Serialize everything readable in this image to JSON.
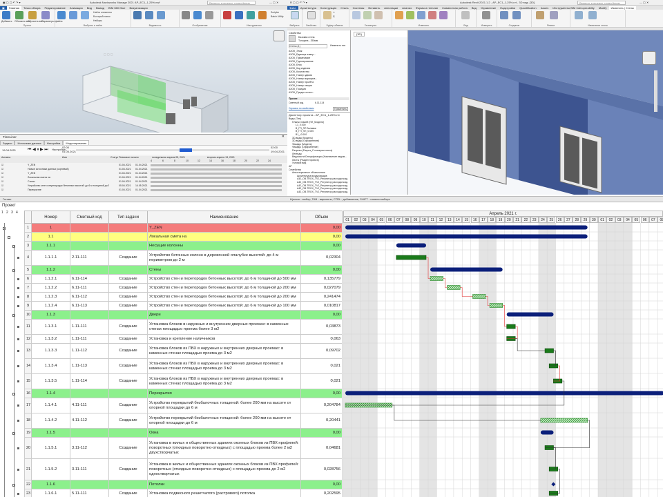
{
  "navisworks": {
    "title": "Autodesk Navisworks Manage 2021   АР_ЕС1_1-25%.nwf",
    "search_placeholder": "Введите ключевое слово/фразу",
    "tabs": [
      "Главная",
      "Точка обзора",
      "Редактирование",
      "Анимация",
      "Вид",
      "Вывод",
      "BIM 360 Glue",
      "Визуализация"
    ],
    "groups": [
      "Проект",
      "Выбрать и найти",
      "Видимость",
      "Отображение",
      "Инструменты"
    ],
    "buttons": [
      "Добавить",
      "Обновить все",
      "Сбросить все",
      "Параметры файла",
      "Выбрать",
      "Сохранить выбор",
      "Выбрать все",
      "Найти элементы",
      "Быстрый поиск",
      "Наборы",
      "Скрыть",
      "Скрыть невыбранное",
      "Отобразить все",
      "Ссылки",
      "Быстрые свойства",
      "Свойства",
      "Clash Detective",
      "TimeLiner",
      "Quantification",
      "Autodesk Rendering",
      "Animator",
      "Scripter",
      "Appearance Profiler",
      "Batch Utility",
      "Сравнить",
      "DataTools",
      "App Manager"
    ]
  },
  "timeliner": {
    "title": "TimeLiner",
    "tabs": [
      "Задачи",
      "Источники данных",
      "Настройка",
      "Моделирование"
    ],
    "play_time": "02:00",
    "date_start": "19.04.2021",
    "date_end": "01.04.2021",
    "date_right": "19.04.2021",
    "cols": [
      "Активна",
      "Имя",
      "Статус",
      "Плановое начало",
      "Плановое окончание",
      "понедельник апреля 05, 2021",
      "вторник апреля 13, 2021"
    ],
    "rows": [
      {
        "n": "Y_ZEN",
        "d1": "01.04.2021",
        "d2": "01.04.2021"
      },
      {
        "n": "Новые источники данных (корневой)",
        "d1": "01.04.2021",
        "d2": "01.04.2021"
      },
      {
        "n": "Y_ZEN",
        "d1": "01.04.2021",
        "d2": "01.04.2021"
      },
      {
        "n": "Локальная смета на",
        "d1": "01.04.2021",
        "d2": "01.04.2021"
      },
      {
        "n": "Стены",
        "d1": "01.04.2021",
        "d2": "01.04.2021"
      },
      {
        "n": "Устройство стен и перегородок бетонных высотой: до 6 м толщиной до 500 мм",
        "d1": "05.04.2021",
        "d2": "14.05.2021"
      },
      {
        "n": "Перекрытие",
        "d1": "01.04.2021",
        "d2": "01.04.2021"
      }
    ],
    "scale": [
      "4",
      "6",
      "8",
      "10",
      "12",
      "14",
      "16",
      "18",
      "20",
      "22",
      "24"
    ]
  },
  "revit": {
    "title": "Autodesk Revit 2021.1.2 - АР_ЕС1_1-25%.rvt - 3D вид: {3D}",
    "search_placeholder": "Введите ключевое слово/фразу",
    "tabs": [
      "Файл",
      "Архитектура",
      "Конструкция",
      "Сталь",
      "Системы",
      "Вставить",
      "Аннотации",
      "Анализ",
      "Формы и генплан",
      "Совместная работа",
      "Вид",
      "Управление",
      "Надстройки",
      "Quantification",
      "Issues",
      "Инструменты BIM Interoperability",
      "Modify",
      "Изменить | Стены"
    ],
    "groups": [
      "Выбрать",
      "Свойства",
      "Буфер обмена",
      "Геометрия",
      "Изменить",
      "Вид",
      "Измерить",
      "Создание",
      "Режим",
      "Изменение стены"
    ],
    "doc_tab": "{3D}",
    "properties": {
      "header": "Свойства",
      "type_name": "Базовая стена",
      "type_sub": "Толщина - 250мм",
      "filter": "Стены (1)",
      "edit_type": "Изменить тип",
      "items": [
        "АЗОК_Этаж",
        "АЗОК_Единица измер...",
        "АЗОК_Примечание",
        "АЗОК_Группирование",
        "АЗОК_Блок",
        "АЗОК_Код изделия",
        "АЗОК_Количество",
        "АЗОК_Номер здания",
        "АЗОК_Номер маркиров...",
        "АЗОК_Номер пролёта",
        "АЗОК_Номер секции",
        "АЗОК_Позиция",
        "АЗОК_Предел огнест..."
      ],
      "other_header": "Прочее",
      "smeta_label": "Сметный код",
      "smeta_value": "6.11-114",
      "help": "Справка по свойствам",
      "apply": "Применить"
    },
    "browser": {
      "header": "Диспетчер проекта - АР_ЕС1_1-25%.rvt",
      "items": [
        "Виды (Тип)",
        "Планы этажей (ПЛ_Модели)",
        "L1_0.000",
        "В_ГП_ПЛ Заливки",
        "В_ГП_ПЛ_0.000",
        "В1_-0.000",
        "3D-виды (Модель)",
        "3D-виды (Оформление)",
        "Фасады (Модель)",
        "Фасады (Оформление)",
        "Разрезы (Разрез_С номером листа)",
        "Легенды",
        "Ведомости/Спецификации (Назначение ведом...",
        "Листы (Раздел проекта)",
        "Узловой вид",
        "АР",
        "Семейства",
        "Аннотационные обозначения",
        "Архитектура воздуховодов",
        "А42_OB.TROX_TVJ_Регулятор расхода возд.",
        "А42_OB.TROX_TVJ_Регулятор расхода возд.",
        "А42_OB.TROX_TVJ_Регулятор расхода возд.",
        "А42_OB.TROX_TVJ_Регулятор расхода возд.",
        "А42_OB.TROX_TVJ_Регулятор расхода возд."
      ]
    },
    "status": "Щелчок - выбор, TAB - варианты, CTRL - добавление, SHIFT - отмена выбора"
  },
  "navis_status": "Готово",
  "project": {
    "label": "Проект",
    "outline_levels": [
      "1",
      "2",
      "3",
      "4"
    ],
    "columns": {
      "number": "Номер",
      "code": "Сметный код",
      "type": "Тип задачи",
      "name": "Наименование",
      "volume": "Объем"
    },
    "rows": [
      {
        "id": "1",
        "num": "1",
        "code": "",
        "type": "",
        "name": "Y_ZEN",
        "vol": "0,00",
        "color": "red",
        "h": 1
      },
      {
        "id": "2",
        "num": "1.1",
        "code": "",
        "type": "",
        "name": "Локальная смета на",
        "vol": "0,00",
        "color": "yellow",
        "h": 1
      },
      {
        "id": "3",
        "num": "1.1.1",
        "code": "",
        "type": "",
        "name": "Несущие колонны",
        "vol": "0,00",
        "color": "green",
        "h": 1
      },
      {
        "id": "4",
        "num": "1.1.1.1",
        "code": "2.11-111",
        "type": "Создание",
        "name": "Устройство бетонных колонн в деревянной опалубке высотой: до 4 м периметром до 2 м",
        "vol": "0,02304",
        "color": "",
        "h": 2
      },
      {
        "id": "5",
        "num": "1.1.2",
        "code": "",
        "type": "",
        "name": "Стены",
        "vol": "0,00",
        "color": "green",
        "h": 1
      },
      {
        "id": "6",
        "num": "1.1.2.1",
        "code": "6.11-114",
        "type": "Создание",
        "name": "Устройство стен и перегородок бетонных высотой: до 6 м толщиной до 500 мм",
        "vol": "0,135779",
        "color": "",
        "h": 1
      },
      {
        "id": "7",
        "num": "1.1.2.2",
        "code": "6.11-111",
        "type": "Создание",
        "name": "Устройство стен и перегородок бетонных высотой: до 6 м толщиной до 200 мм",
        "vol": "0,027079",
        "color": "",
        "h": 1
      },
      {
        "id": "8",
        "num": "1.1.2.3",
        "code": "6.11-112",
        "type": "Создание",
        "name": "Устройство стен и перегородок бетонных высотой: до 6 м толщиной до 200 мм",
        "vol": "0,241474",
        "color": "",
        "h": 1
      },
      {
        "id": "9",
        "num": "1.1.2.4",
        "code": "6.11-113",
        "type": "Создание",
        "name": "Устройство стен и перегородок бетонных высотой: до 6 м толщиной до 100 мм",
        "vol": "0,010817",
        "color": "",
        "h": 1
      },
      {
        "id": "10",
        "num": "1.1.3",
        "code": "",
        "type": "",
        "name": "Двери",
        "vol": "0,00",
        "color": "green",
        "h": 1
      },
      {
        "id": "11",
        "num": "1.1.3.1",
        "code": "1.11-111",
        "type": "Создание",
        "name": "Установка блоков в наружных и внутренних дверных проемах: в каменных стенах площадью проема более 3 м2",
        "vol": "0,03873",
        "color": "",
        "h": 2
      },
      {
        "id": "12",
        "num": "1.1.3.2",
        "code": "1.11-111",
        "type": "Создание",
        "name": "Установка и крепление наличников",
        "vol": "0,063",
        "color": "",
        "h": 1
      },
      {
        "id": "13",
        "num": "1.1.3.3",
        "code": "1.11-112",
        "type": "Создание",
        "name": "Установка блоков из ПВХ в наружных и внутренних дверных проемах: в каменных стенах площадью проема до 3 м2",
        "vol": "0,09702",
        "color": "",
        "h": 2
      },
      {
        "id": "14",
        "num": "1.1.3.4",
        "code": "1.11-113",
        "type": "Создание",
        "name": "Установка блоков из ПВХ в наружных и внутренних дверных проемах: в каменных стенах площадью проема до 3 м2",
        "vol": "0,021",
        "color": "",
        "h": 2
      },
      {
        "id": "15",
        "num": "1.1.3.5",
        "code": "1.11-114",
        "type": "Создание",
        "name": "Установка блоков из ПВХ в наружных и внутренних дверных проемах: в каменных стенах площадью проема до 3 м2",
        "vol": "0,021",
        "color": "",
        "h": 2
      },
      {
        "id": "16",
        "num": "1.1.4",
        "code": "",
        "type": "",
        "name": "Перекрытия",
        "vol": "0,00",
        "color": "green",
        "h": 1
      },
      {
        "id": "17",
        "num": "1.1.4.1",
        "code": "4.11-111",
        "type": "Создание",
        "name": "Устройство перекрытий безбалочных толщиной: более 200 мм на высоте от опорной площадки до 6 м",
        "vol": "0,204784",
        "color": "",
        "h": 2
      },
      {
        "id": "18",
        "num": "1.1.4.2",
        "code": "4.11-112",
        "type": "Создание",
        "name": "Устройство перекрытий безбалочных толщиной: более 200 мм на высоте от опорной площадки до 6 м",
        "vol": "0,20441",
        "color": "",
        "h": 2
      },
      {
        "id": "19",
        "num": "1.1.5",
        "code": "",
        "type": "",
        "name": "Окна",
        "vol": "0,00",
        "color": "green",
        "h": 1
      },
      {
        "id": "20",
        "num": "1.1.5.1",
        "code": "3.11-112",
        "type": "Создание",
        "name": "Установка в жилых и общественных зданиях оконных блоков из ПВХ профилей: поворотных (откидных поворотно-откидных) с площадью проема более 2 м2 двухстворчатых",
        "vol": "0,04681",
        "color": "",
        "h": 3
      },
      {
        "id": "21",
        "num": "1.1.5.2",
        "code": "3.11-111",
        "type": "Создание",
        "name": "Установка в жилых и общественных зданиях оконных блоков из ПВХ профилей: поворотных (откидных поворотно-откидных) с площадью проема до 2 м2 одностворчатых",
        "vol": "0,028756",
        "color": "",
        "h": 3
      },
      {
        "id": "22",
        "num": "1.1.6",
        "code": "",
        "type": "",
        "name": "Потолки",
        "vol": "0,00",
        "color": "green",
        "h": 1
      },
      {
        "id": "23",
        "num": "1.1.6.1",
        "code": "5.11-111",
        "type": "Создание",
        "name": "Установка подвесного решетчатого (растрового) потолка",
        "vol": "0,202595",
        "color": "",
        "h": 1
      }
    ]
  },
  "gantt": {
    "month": "Апрель 2021 г.",
    "days": [
      "01",
      "02",
      "03",
      "04",
      "05",
      "06",
      "07",
      "08",
      "09",
      "10",
      "11",
      "12",
      "13",
      "14",
      "15",
      "16",
      "17",
      "18",
      "19",
      "20",
      "21",
      "22",
      "23",
      "24",
      "25",
      "26",
      "27",
      "28",
      "29",
      "30",
      "01",
      "02",
      "03",
      "04",
      "05",
      "06",
      "07",
      "08"
    ],
    "weekend_days": [
      "03",
      "04",
      "10",
      "11",
      "17",
      "18",
      "24",
      "25",
      "01",
      "02"
    ],
    "colors": {
      "summary": "#0b1f7a",
      "task": "#1a7a1a",
      "link": "#e03030",
      "link_gray": "#333333",
      "weekend": "#e4e4e4"
    },
    "bars": [
      {
        "row": 1,
        "kind": "summary",
        "start": 1,
        "end": 29
      },
      {
        "row": 2,
        "kind": "summary",
        "start": 1,
        "end": 29
      },
      {
        "row": 3,
        "kind": "summary",
        "start": 7,
        "end": 10
      },
      {
        "row": 4,
        "kind": "task",
        "start": 7,
        "end": 10
      },
      {
        "row": 5,
        "kind": "summary",
        "start": 11,
        "end": 19
      },
      {
        "row": 6,
        "kind": "hatch",
        "start": 11,
        "end": 12
      },
      {
        "row": 7,
        "kind": "hatch",
        "start": 13,
        "end": 14
      },
      {
        "row": 8,
        "kind": "hatch",
        "start": 16,
        "end": 17
      },
      {
        "row": 9,
        "kind": "hatch",
        "start": 18,
        "end": 19
      },
      {
        "row": 10,
        "kind": "summary",
        "start": 20,
        "end": 25
      },
      {
        "row": 11,
        "kind": "task",
        "start": 20,
        "end": 20.5
      },
      {
        "row": 12,
        "kind": "task",
        "start": 20,
        "end": 20.5
      },
      {
        "row": 13,
        "kind": "task",
        "start": 24.5,
        "end": 25
      },
      {
        "row": 14,
        "kind": "task",
        "start": 25,
        "end": 25.5
      },
      {
        "row": 15,
        "kind": "task",
        "start": 25.5,
        "end": 26
      },
      {
        "row": 16,
        "kind": "summary",
        "start": 1,
        "end": 38
      },
      {
        "row": 17,
        "kind": "hatch",
        "start": 1,
        "end": 6
      },
      {
        "row": 18,
        "kind": "hatch",
        "start": 24,
        "end": 29
      },
      {
        "row": 19,
        "kind": "summary",
        "start": 24,
        "end": 25
      },
      {
        "row": 20,
        "kind": "task",
        "start": 24.5,
        "end": 25
      },
      {
        "row": 21,
        "kind": "task",
        "start": 25,
        "end": 25.5
      },
      {
        "row": 22,
        "kind": "milestone",
        "start": 25.5,
        "end": 25.5
      },
      {
        "row": 23,
        "kind": "task",
        "start": 25,
        "end": 25.5
      }
    ]
  }
}
